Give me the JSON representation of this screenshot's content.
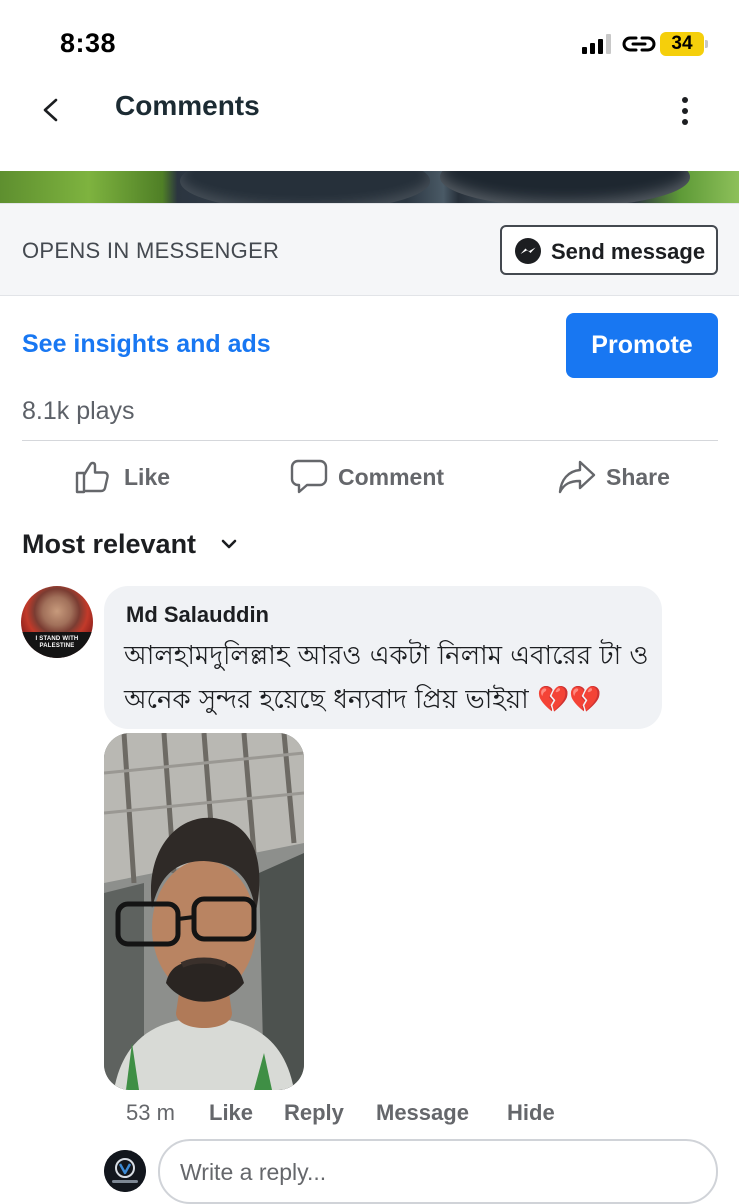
{
  "status_bar": {
    "time": "8:38",
    "battery": "34",
    "icons": [
      "signal-bars-icon",
      "link-icon",
      "battery-icon"
    ]
  },
  "header": {
    "title": "Comments",
    "back_icon": "chevron-left-icon",
    "more_icon": "more-vertical-icon"
  },
  "messenger": {
    "label": "OPENS IN MESSENGER",
    "send_label": "Send message",
    "icon": "messenger-icon"
  },
  "insights": {
    "link_label": "See insights and ads",
    "promote_label": "Promote"
  },
  "plays": "8.1k plays",
  "actions": [
    {
      "label": "Like",
      "icon": "thumbs-up-icon"
    },
    {
      "label": "Comment",
      "icon": "speech-bubble-icon"
    },
    {
      "label": "Share",
      "icon": "share-arrow-icon"
    }
  ],
  "sort": {
    "label": "Most relevant",
    "icon": "chevron-down-icon"
  },
  "comment": {
    "author": "Md Salauddin",
    "avatar_text": "I STAND WITH PALESTINE",
    "text_line1": "আলহামদুলিল্লাহ আরও একটা নিলাম এবারের টা ও",
    "text_line2": "অনেক সুন্দর হয়েছে ধন্যবাদ প্রিয় ভাইয়া 💔💔",
    "time": "53 m",
    "actions": [
      "Like",
      "Reply",
      "Message",
      "Hide"
    ]
  },
  "reply": {
    "placeholder": "Write a reply..."
  },
  "colors": {
    "accent": "#1877f2",
    "battery": "#f5cf0b",
    "secondary_text": "#65676b",
    "bubble": "#f0f2f5"
  }
}
